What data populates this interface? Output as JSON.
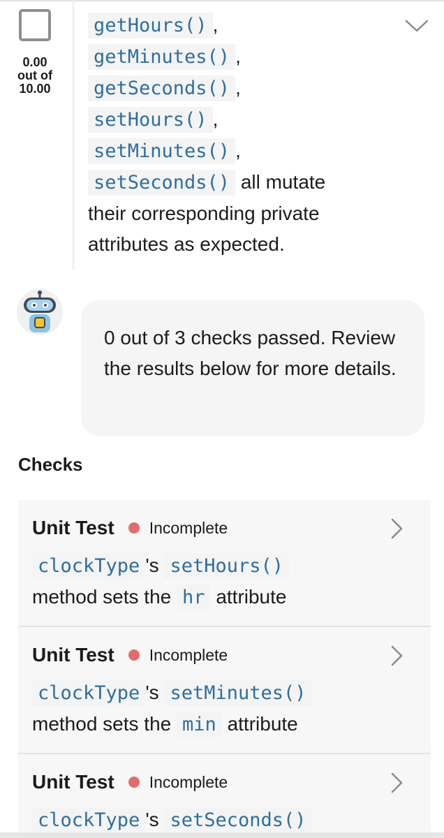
{
  "requirement": {
    "score": {
      "value": "0.00",
      "out_of_label": "out of",
      "max": "10.00"
    },
    "methods": [
      "getHours()",
      "getMinutes()",
      "getSeconds()",
      "setHours()",
      "setMinutes()",
      "setSeconds()"
    ],
    "separator": ",",
    "text_tail_line1": "all mutate",
    "text_tail_line2": "their corresponding private",
    "text_tail_line3": "attributes as expected."
  },
  "assistant": {
    "avatar_icon": "robot-icon",
    "message": "0 out of 3 checks passed. Review the results below for more details."
  },
  "checks": {
    "heading": "Checks",
    "items": [
      {
        "type": "Unit Test",
        "status": "Incomplete",
        "subject": "clockType",
        "possessive": "'s",
        "method": "setHours()",
        "desc_mid": "method sets the",
        "attr": "hr",
        "desc_end": "attribute"
      },
      {
        "type": "Unit Test",
        "status": "Incomplete",
        "subject": "clockType",
        "possessive": "'s",
        "method": "setMinutes()",
        "desc_mid": "method sets the",
        "attr": "min",
        "desc_end": "attribute"
      },
      {
        "type": "Unit Test",
        "status": "Incomplete",
        "subject": "clockType",
        "possessive": "'s",
        "method": "setSeconds()",
        "desc_mid": "",
        "attr": "",
        "desc_end": ""
      }
    ],
    "status_color": "#e36b6b"
  },
  "colors": {
    "code_text": "#2e6e9e",
    "code_bg": "#f4f4f4",
    "card_bg": "#f7f7f7"
  }
}
